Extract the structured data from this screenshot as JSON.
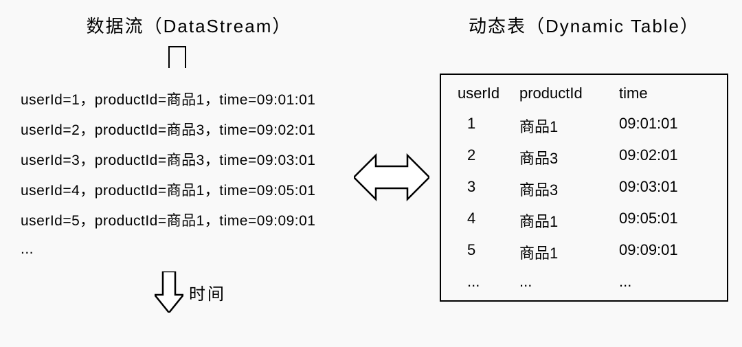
{
  "stream": {
    "title": "数据流（DataStream）",
    "records": [
      "userId=1，productId=商品1，time=09:01:01",
      "userId=2，productId=商品3，time=09:02:01",
      "userId=3，productId=商品3，time=09:03:01",
      "userId=4，productId=商品1，time=09:05:01",
      "userId=5，productId=商品1，time=09:09:01"
    ],
    "ellipsis": "...",
    "time_label": "时间"
  },
  "table": {
    "title": "动态表（Dynamic Table）",
    "headers": [
      "userId",
      "productId",
      "time"
    ],
    "rows": [
      {
        "userId": "1",
        "productId": "商品1",
        "time": "09:01:01"
      },
      {
        "userId": "2",
        "productId": "商品3",
        "time": "09:02:01"
      },
      {
        "userId": "3",
        "productId": "商品3",
        "time": "09:03:01"
      },
      {
        "userId": "4",
        "productId": "商品1",
        "time": "09:05:01"
      },
      {
        "userId": "5",
        "productId": "商品1",
        "time": "09:09:01"
      }
    ],
    "ellipsis": "..."
  }
}
